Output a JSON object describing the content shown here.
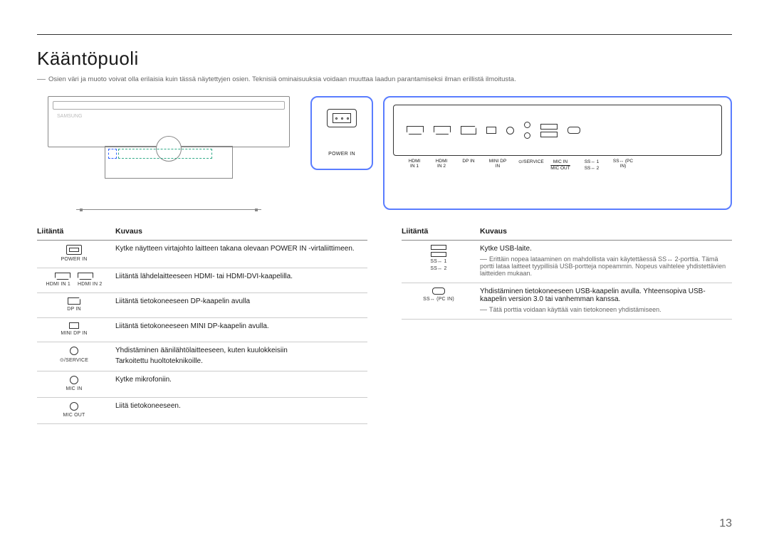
{
  "page_number": "13",
  "title": "Kääntöpuoli",
  "intro_note": "Osien väri ja muoto voivat olla erilaisia kuin tässä näytettyjen osien. Teknisiä ominaisuuksia voidaan muuttaa laadun parantamiseksi ilman erillistä ilmoitusta.",
  "diagram": {
    "power_label": "POWER IN",
    "panel_labels": [
      "HDMI IN 1",
      "HDMI IN 2",
      "DP IN",
      "MINI DP IN",
      "⊙/SERVICE",
      "MIC IN",
      "MIC OUT",
      "SS↔ 1",
      "SS↔ 2",
      "SS↔ (PC IN)"
    ]
  },
  "table_headers": {
    "port": "Liitäntä",
    "desc": "Kuvaus"
  },
  "left_rows": [
    {
      "icon": "power",
      "label": "POWER IN",
      "desc": "Kytke näytteen virtajohto laitteen takana olevaan POWER IN -virtaliittimeen."
    },
    {
      "icon": "hdmi2",
      "label1": "HDMI IN 1",
      "label2": "HDMI IN 2",
      "desc": "Liitäntä lähdelaitteeseen HDMI- tai HDMI-DVI-kaapelilla."
    },
    {
      "icon": "dp",
      "label": "DP IN",
      "desc": "Liitäntä tietokoneeseen DP-kaapelin avulla"
    },
    {
      "icon": "mdp",
      "label": "MINI DP IN",
      "desc": "Liitäntä tietokoneeseen MINI DP-kaapelin avulla."
    },
    {
      "icon": "jack",
      "label": "⊙/SERVICE",
      "desc": "Yhdistäminen äänilähtölaitteeseen, kuten kuulokkeisiin",
      "sub": "Tarkoitettu huoltoteknikoille."
    },
    {
      "icon": "jack",
      "label": "MIC IN",
      "desc": "Kytke mikrofoniin."
    },
    {
      "icon": "jack",
      "label": "MIC OUT",
      "desc": "Liitä tietokoneeseen."
    }
  ],
  "right_rows": [
    {
      "icon": "usb2",
      "label1": "SS↔ 1",
      "label2": "SS↔ 2",
      "desc": "Kytke USB-laite.",
      "sub": "Erittäin nopea lataaminen on mahdollista vain käytettäessä SS↔ 2-porttia. Tämä portti lataa laitteet tyypillisiä USB-portteja nopeammin. Nopeus vaihtelee yhdistettävien laitteiden mukaan."
    },
    {
      "icon": "usbc",
      "label": "SS↔ (PC IN)",
      "desc": "Yhdistäminen tietokoneeseen USB-kaapelin avulla. Yhteensopiva USB-kaapelin version 3.0 tai vanhemman kanssa.",
      "sub": "Tätä porttia voidaan käyttää vain tietokoneen yhdistämiseen."
    }
  ]
}
